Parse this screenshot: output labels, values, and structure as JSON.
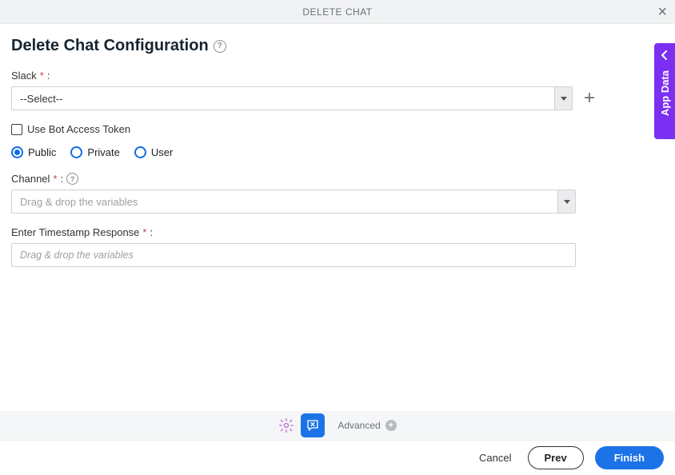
{
  "header": {
    "title": "DELETE CHAT"
  },
  "page": {
    "title": "Delete Chat Configuration"
  },
  "slack": {
    "label": "Slack",
    "required": "*",
    "select_value": "--Select--"
  },
  "bot_token": {
    "label": "Use Bot Access Token"
  },
  "scope_options": {
    "opt1": "Public",
    "opt2": "Private",
    "opt3": "User"
  },
  "channel": {
    "label": "Channel",
    "required": "*",
    "placeholder": "Drag & drop the variables"
  },
  "timestamp": {
    "label": "Enter Timestamp Response",
    "required": "*",
    "placeholder": "Drag & drop the variables"
  },
  "toolbar": {
    "advanced": "Advanced"
  },
  "footer": {
    "cancel": "Cancel",
    "prev": "Prev",
    "finish": "Finish"
  },
  "side_panel": {
    "label": "App Data"
  }
}
